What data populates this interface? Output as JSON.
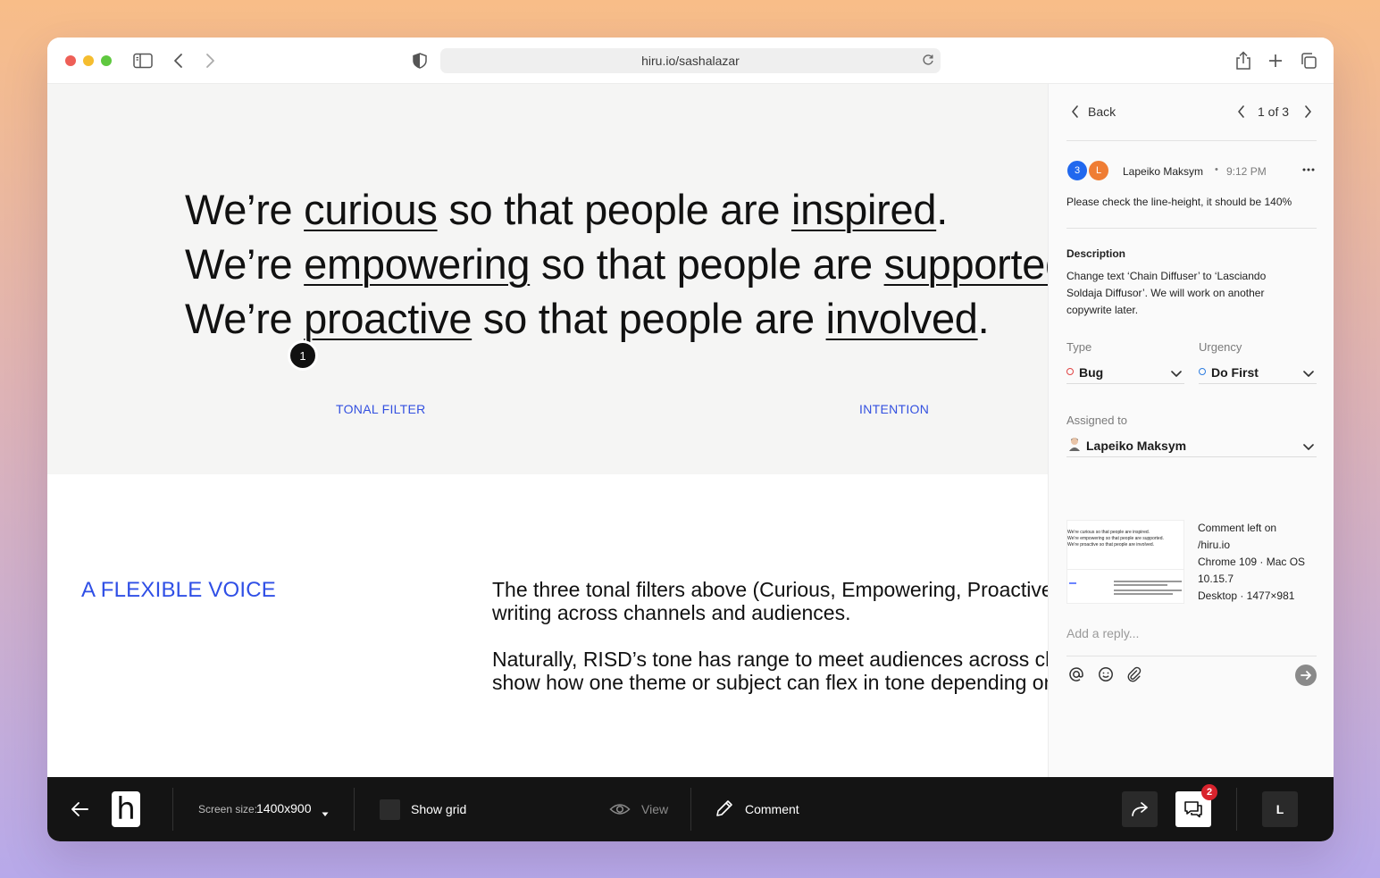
{
  "browser": {
    "url": "hiru.io/sashalazar"
  },
  "hero": {
    "lines": [
      {
        "pre": "We’re ",
        "word": "curious",
        "mid": " so that people are ",
        "end_word": "inspired",
        "post": "."
      },
      {
        "pre": "We’re ",
        "word": "empowering",
        "mid": " so that people are ",
        "end_word": "supported",
        "post": "."
      },
      {
        "pre": "We’re ",
        "word": "proactive",
        "mid": " so that people are ",
        "end_word": "involved",
        "post": "."
      }
    ],
    "label_left": "TONAL FILTER",
    "label_right": "INTENTION",
    "pin": "1"
  },
  "section": {
    "title": "A FLEXIBLE VOICE",
    "para1_line1": "The three tonal filters above (Curious, Empowering, Proactive) drive",
    "para1_line2": "writing across channels and audiences.",
    "para2_line1": "Naturally, RISD’s tone has range to meet audiences across channels. We",
    "para2_line2": "show how one theme or subject can flex in tone depending on context."
  },
  "panel": {
    "back_label": "Back",
    "pager": "1 of 3",
    "avatar_count": "3",
    "avatar_initial": "L",
    "author": "Lapeiko Maksym",
    "time": "9:12 PM",
    "bullet": "•",
    "comment": "Please check the line-height, it should be 140%",
    "description_label": "Description",
    "description_lines": [
      "Change text  ‘Chain Diffuser’ to ‘Lasciando",
      "Soldaja Diffusor’. We will work on another",
      "copywrite later."
    ],
    "type_label": "Type",
    "type_value": "Bug",
    "type_color": "#e04444",
    "urgency_label": "Urgency",
    "urgency_value": "Do First",
    "urgency_color": "#2e7de0",
    "assigned_label": "Assigned to",
    "assigned_value": "Lapeiko Maksym",
    "meta_lines": [
      "Comment left on",
      "/hiru.io",
      "Chrome 109 · Mac OS",
      "10.15.7",
      "Desktop · 1477×981"
    ],
    "thumb": {
      "line1": "We're curious so that people are inspired.",
      "line2": "We're empowering so that people are supported.",
      "line3": "We're proactive so that people are involved."
    },
    "reply_placeholder": "Add a reply..."
  },
  "toolbar": {
    "logo": "h",
    "screen_size_label": "Screen size:",
    "screen_size_value": "1400x900",
    "show_grid": "Show grid",
    "view": "View",
    "comment": "Comment",
    "badge_count": "2",
    "user_initial": "L"
  }
}
